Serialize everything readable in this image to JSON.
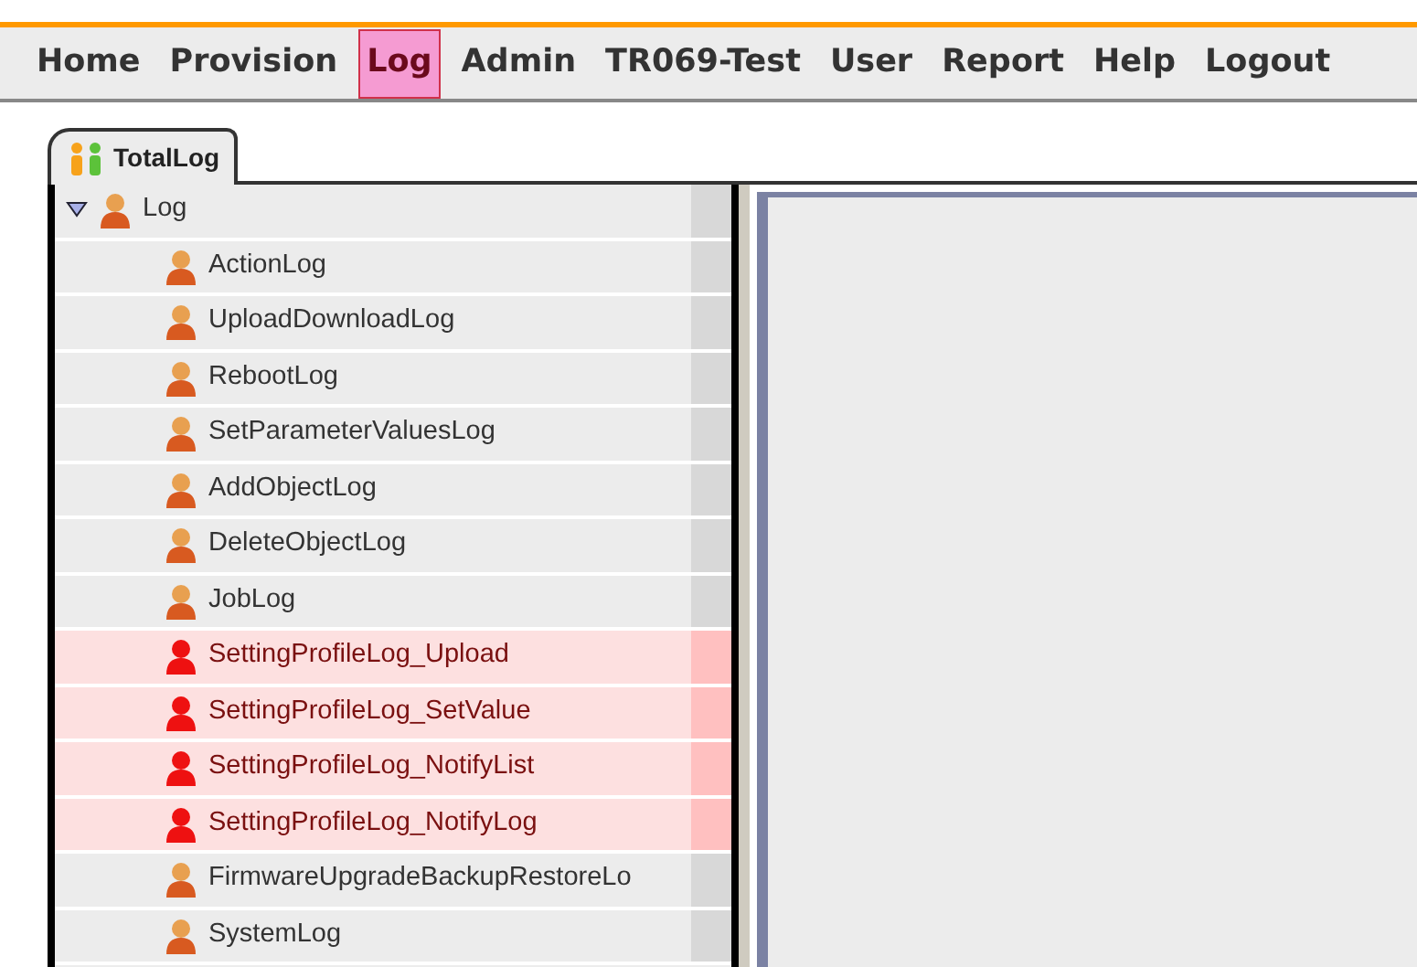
{
  "menu": [
    {
      "label": "Home",
      "selected": false
    },
    {
      "label": "Provision",
      "selected": false
    },
    {
      "label": "Log",
      "selected": true
    },
    {
      "label": "Admin",
      "selected": false
    },
    {
      "label": "TR069-Test",
      "selected": false
    },
    {
      "label": "User",
      "selected": false
    },
    {
      "label": "Report",
      "selected": false
    },
    {
      "label": "Help",
      "selected": false
    },
    {
      "label": "Logout",
      "selected": false
    }
  ],
  "tabs": [
    {
      "label": "TotalLog",
      "selected": true
    }
  ],
  "tree": [
    {
      "label": "Log",
      "expanded": true,
      "children": [
        {
          "label": "ActionLog",
          "highlighted": false
        },
        {
          "label": "UploadDownloadLog",
          "highlighted": false
        },
        {
          "label": "RebootLog",
          "highlighted": false
        },
        {
          "label": "SetParameterValuesLog",
          "highlighted": false
        },
        {
          "label": "AddObjectLog",
          "highlighted": false
        },
        {
          "label": "DeleteObjectLog",
          "highlighted": false
        },
        {
          "label": "JobLog",
          "highlighted": false
        },
        {
          "label": "SettingProfileLog_Upload",
          "highlighted": true
        },
        {
          "label": "SettingProfileLog_SetValue",
          "highlighted": true
        },
        {
          "label": "SettingProfileLog_NotifyList",
          "highlighted": true
        },
        {
          "label": "SettingProfileLog_NotifyLog",
          "highlighted": true
        },
        {
          "label": "FirmwareUpgradeBackupRestoreLo",
          "highlighted": false
        },
        {
          "label": "SystemLog",
          "highlighted": false
        }
      ]
    }
  ]
}
